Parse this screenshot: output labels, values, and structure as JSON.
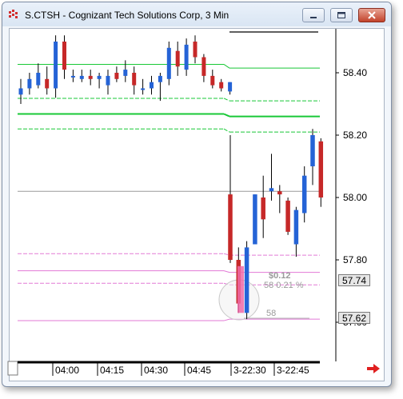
{
  "window": {
    "title": "S.CTSH - Cognizant Tech Solutions Corp, 3 Min",
    "icon": "chart-app-icon",
    "buttons": [
      "minimize-icon",
      "maximize-icon",
      "close-icon"
    ]
  },
  "price_axis": {
    "labels": [
      "58.40",
      "58.20",
      "58.00",
      "57.80",
      "57.60"
    ],
    "label_values": [
      58.4,
      58.2,
      58.0,
      57.8,
      57.6
    ],
    "tag_current": "57.74",
    "tag_current_value": 57.74,
    "tag_other": "57.62",
    "tag_other_value": 57.62
  },
  "time_axis": {
    "labels": [
      "04:00",
      "04:15",
      "04:30",
      "04:45",
      "3-22:30",
      "3-22:45"
    ]
  },
  "overlay": {
    "change_text": "$0.12",
    "price_pct_text": "58 0.21 %",
    "level_text": "58"
  },
  "reference_lines": {
    "green_solid_upper": 58.415,
    "green_dashed_upper": 58.31,
    "green_solid_mid": 58.26,
    "green_dashed_lower": 58.21,
    "gray_line": 58.02,
    "pink_dashed_upper": 57.815,
    "pink_solid_mid": 57.76,
    "pink_dashed_lower": 57.72,
    "pink_solid_lower": 57.61
  },
  "colors": {
    "up": "#2563d6",
    "down": "#c62828",
    "green": "#19c837",
    "pink": "#e27ad6",
    "gray": "#9a9a9a"
  },
  "chart_data": {
    "type": "candlestick",
    "title": "S.CTSH - Cognizant Tech Solutions Corp, 3 Min",
    "ylim": [
      57.55,
      58.6
    ],
    "x_categories": [
      "04:00",
      "04:15",
      "04:30",
      "04:45",
      "3-22:30",
      "3-22:45"
    ],
    "session1": [
      {
        "o": 58.33,
        "h": 58.38,
        "l": 58.3,
        "c": 58.35
      },
      {
        "o": 58.35,
        "h": 58.4,
        "l": 58.33,
        "c": 58.38
      },
      {
        "o": 58.36,
        "h": 58.43,
        "l": 58.35,
        "c": 58.4
      },
      {
        "o": 58.38,
        "h": 58.42,
        "l": 58.33,
        "c": 58.35
      },
      {
        "o": 58.35,
        "h": 58.52,
        "l": 58.32,
        "c": 58.5
      },
      {
        "o": 58.5,
        "h": 58.52,
        "l": 58.38,
        "c": 58.41
      },
      {
        "o": 58.39,
        "h": 58.41,
        "l": 58.37,
        "c": 58.39
      },
      {
        "o": 58.38,
        "h": 58.41,
        "l": 58.37,
        "c": 58.39
      },
      {
        "o": 58.39,
        "h": 58.41,
        "l": 58.36,
        "c": 58.38
      },
      {
        "o": 58.38,
        "h": 58.4,
        "l": 58.35,
        "c": 58.39
      },
      {
        "o": 58.36,
        "h": 58.41,
        "l": 58.33,
        "c": 58.39
      },
      {
        "o": 58.4,
        "h": 58.42,
        "l": 58.37,
        "c": 58.38
      },
      {
        "o": 58.39,
        "h": 58.44,
        "l": 58.37,
        "c": 58.41
      },
      {
        "o": 58.4,
        "h": 58.42,
        "l": 58.33,
        "c": 58.36
      },
      {
        "o": 58.35,
        "h": 58.38,
        "l": 58.33,
        "c": 58.35
      },
      {
        "o": 58.35,
        "h": 58.39,
        "l": 58.33,
        "c": 58.37
      },
      {
        "o": 58.37,
        "h": 58.4,
        "l": 58.31,
        "c": 58.39
      },
      {
        "o": 58.38,
        "h": 58.5,
        "l": 58.36,
        "c": 58.48
      },
      {
        "o": 58.47,
        "h": 58.5,
        "l": 58.39,
        "c": 58.42
      },
      {
        "o": 58.41,
        "h": 58.51,
        "l": 58.39,
        "c": 58.49
      },
      {
        "o": 58.5,
        "h": 58.52,
        "l": 58.43,
        "c": 58.45
      },
      {
        "o": 58.45,
        "h": 58.46,
        "l": 58.37,
        "c": 58.39
      },
      {
        "o": 58.39,
        "h": 58.41,
        "l": 58.35,
        "c": 58.36
      },
      {
        "o": 58.37,
        "h": 58.38,
        "l": 58.34,
        "c": 58.35
      },
      {
        "o": 58.34,
        "h": 58.37,
        "l": 58.33,
        "c": 58.37
      }
    ],
    "session2": [
      {
        "o": 58.01,
        "h": 58.2,
        "l": 57.79,
        "c": 57.8
      },
      {
        "o": 57.8,
        "h": 57.84,
        "l": 57.63,
        "c": 57.66
      },
      {
        "o": 57.63,
        "h": 57.86,
        "l": 57.61,
        "c": 57.84
      },
      {
        "o": 57.85,
        "h": 58.01,
        "l": 57.85,
        "c": 58.01
      },
      {
        "o": 58.0,
        "h": 58.07,
        "l": 57.87,
        "c": 57.93
      },
      {
        "o": 58.02,
        "h": 58.14,
        "l": 57.99,
        "c": 58.03
      },
      {
        "o": 58.02,
        "h": 58.04,
        "l": 57.95,
        "c": 58.01
      },
      {
        "o": 57.99,
        "h": 58.0,
        "l": 57.88,
        "c": 57.89
      },
      {
        "o": 57.85,
        "h": 57.97,
        "l": 57.81,
        "c": 57.96
      },
      {
        "o": 57.95,
        "h": 58.1,
        "l": 57.92,
        "c": 58.07
      },
      {
        "o": 58.1,
        "h": 58.22,
        "l": 58.04,
        "c": 58.2
      },
      {
        "o": 58.18,
        "h": 58.19,
        "l": 57.97,
        "c": 58.0
      }
    ]
  }
}
